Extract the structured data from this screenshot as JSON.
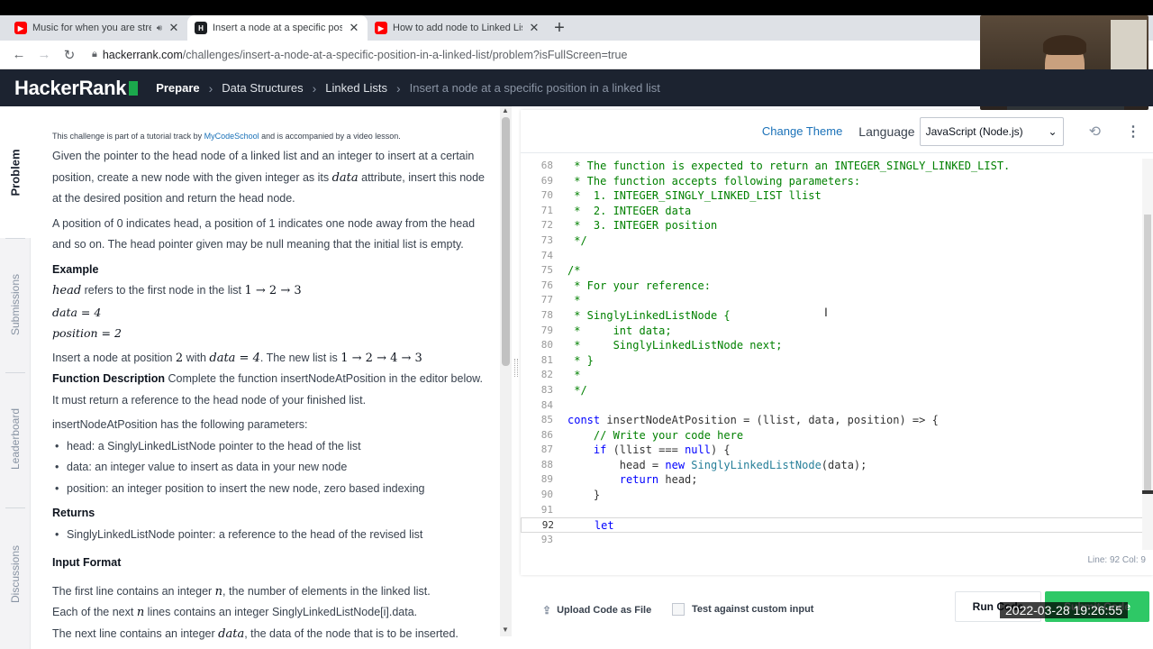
{
  "browser": {
    "tabs": [
      {
        "title": "Music for when you are stressed",
        "favicon": "youtube-icon",
        "audio": true
      },
      {
        "title": "Insert a node at a specific position",
        "favicon": "hackerrank-icon",
        "active": true
      },
      {
        "title": "How to add node to Linked List | ",
        "favicon": "youtube-icon"
      }
    ],
    "url_host": "hackerrank.com",
    "url_path": "/challenges/insert-a-node-at-a-specific-position-in-a-linked-list/problem?isFullScreen=true"
  },
  "header": {
    "logo": "HackerRank",
    "breadcrumbs": [
      "Prepare",
      "Data Structures",
      "Linked Lists",
      "Insert a node at a specific position in a linked list"
    ]
  },
  "side_tabs": [
    "Problem",
    "Submissions",
    "Leaderboard",
    "Discussions"
  ],
  "problem": {
    "intro_prefix": "This challenge is part of a tutorial track by ",
    "intro_link": "MyCodeSchool",
    "intro_suffix": " and is accompanied by a video lesson.",
    "para1_a": "Given the pointer to the head node of a linked list and an integer to insert at a certain position, create a new node with the given integer as its ",
    "para1_math": "data",
    "para1_b": " attribute, insert this node at the desired position and return the head node.",
    "para2": "A position of 0 indicates head, a position of 1 indicates one node away from the head and so on. The head pointer given may be null meaning that the initial list is empty.",
    "example_heading": "Example",
    "ex_head_var": "head",
    "ex_head_text": " refers to the first node in the list ",
    "ex_head_list": "1 → 2 → 3",
    "ex_data": "data = 4",
    "ex_position": "position = 2",
    "insert_a": "Insert a node at position ",
    "insert_pos": "2",
    "insert_b": " with ",
    "insert_data": "data = 4",
    "insert_c": ". The new list is ",
    "insert_list": "1 → 2 → 4 → 3",
    "func_heading": "Function Description",
    "func_text": " Complete the function insertNodeAtPosition in the editor below. It must return a reference to the head node of your finished list.",
    "params_intro": "insertNodeAtPosition has the following parameters:",
    "params": [
      "head: a SinglyLinkedListNode pointer to the head of the list",
      "data: an integer value to insert as data in your new node",
      "position: an integer position to insert the new node, zero based indexing"
    ],
    "returns_heading": "Returns",
    "returns": [
      "SinglyLinkedListNode pointer: a reference to the head of the revised list"
    ],
    "input_heading": "Input Format",
    "input_1a": "The first line contains an integer ",
    "input_1var": "n",
    "input_1b": ", the number of elements in the linked list.",
    "input_2a": "Each of the next ",
    "input_2var": "n",
    "input_2b": " lines contains an integer SinglyLinkedListNode[i].data.",
    "input_3a": "The next line contains an integer ",
    "input_3var": "data",
    "input_3b": ", the data of the node that is to be inserted."
  },
  "editor": {
    "change_theme": "Change Theme",
    "language_label": "Language",
    "language_value": "JavaScript (Node.js)",
    "status": "Line: 92  Col: 9",
    "lines": [
      {
        "n": "68",
        "parts": [
          [
            "cm",
            " * The function is expected to return an INTEGER_SINGLY_LINKED_LIST."
          ]
        ]
      },
      {
        "n": "69",
        "parts": [
          [
            "cm",
            " * The function accepts following parameters:"
          ]
        ]
      },
      {
        "n": "70",
        "parts": [
          [
            "cm",
            " *  1. INTEGER_SINGLY_LINKED_LIST llist"
          ]
        ]
      },
      {
        "n": "71",
        "parts": [
          [
            "cm",
            " *  2. INTEGER data"
          ]
        ]
      },
      {
        "n": "72",
        "parts": [
          [
            "cm",
            " *  3. INTEGER position"
          ]
        ]
      },
      {
        "n": "73",
        "parts": [
          [
            "cm",
            " */"
          ]
        ]
      },
      {
        "n": "74",
        "parts": []
      },
      {
        "n": "75",
        "parts": [
          [
            "cm",
            "/*"
          ]
        ]
      },
      {
        "n": "76",
        "parts": [
          [
            "cm",
            " * For your reference:"
          ]
        ]
      },
      {
        "n": "77",
        "parts": [
          [
            "cm",
            " *"
          ]
        ]
      },
      {
        "n": "78",
        "parts": [
          [
            "cm",
            " * SinglyLinkedListNode {"
          ]
        ]
      },
      {
        "n": "79",
        "parts": [
          [
            "cm",
            " *     int data;"
          ]
        ]
      },
      {
        "n": "80",
        "parts": [
          [
            "cm",
            " *     SinglyLinkedListNode next;"
          ]
        ]
      },
      {
        "n": "81",
        "parts": [
          [
            "cm",
            " * }"
          ]
        ]
      },
      {
        "n": "82",
        "parts": [
          [
            "cm",
            " *"
          ]
        ]
      },
      {
        "n": "83",
        "parts": [
          [
            "cm",
            " */"
          ]
        ]
      },
      {
        "n": "84",
        "parts": []
      },
      {
        "n": "85",
        "parts": [
          [
            "kw",
            "const"
          ],
          [
            "txt",
            " insertNodeAtPosition = (llist, data, position) => {"
          ]
        ]
      },
      {
        "n": "86",
        "parts": [
          [
            "txt",
            "    "
          ],
          [
            "cm",
            "// Write your code here"
          ]
        ]
      },
      {
        "n": "87",
        "parts": [
          [
            "txt",
            "    "
          ],
          [
            "kw",
            "if"
          ],
          [
            "txt",
            " (llist === "
          ],
          [
            "kw",
            "null"
          ],
          [
            "txt",
            ") {"
          ]
        ]
      },
      {
        "n": "88",
        "parts": [
          [
            "txt",
            "        head = "
          ],
          [
            "kw",
            "new"
          ],
          [
            "txt",
            " "
          ],
          [
            "ty",
            "SinglyLinkedListNode"
          ],
          [
            "txt",
            "(data);"
          ]
        ]
      },
      {
        "n": "89",
        "parts": [
          [
            "txt",
            "        "
          ],
          [
            "kw",
            "return"
          ],
          [
            "txt",
            " head;"
          ]
        ]
      },
      {
        "n": "90",
        "parts": [
          [
            "txt",
            "    }"
          ]
        ]
      },
      {
        "n": "91",
        "parts": []
      },
      {
        "n": "92",
        "parts": [
          [
            "txt",
            "    "
          ],
          [
            "kw",
            "let"
          ]
        ],
        "active": true
      },
      {
        "n": "93",
        "parts": []
      }
    ]
  },
  "actions": {
    "upload": "Upload Code as File",
    "custom_input": "Test against custom input",
    "run": "Run Code",
    "submit": "Submit Code"
  },
  "overlay": {
    "timestamp": "2022-03-28  19:26:55"
  },
  "colors": {
    "brand_green": "#1ba94c",
    "header_bg": "#1c2330",
    "submit_green": "#2ec866",
    "link_blue": "#1a71b8"
  }
}
